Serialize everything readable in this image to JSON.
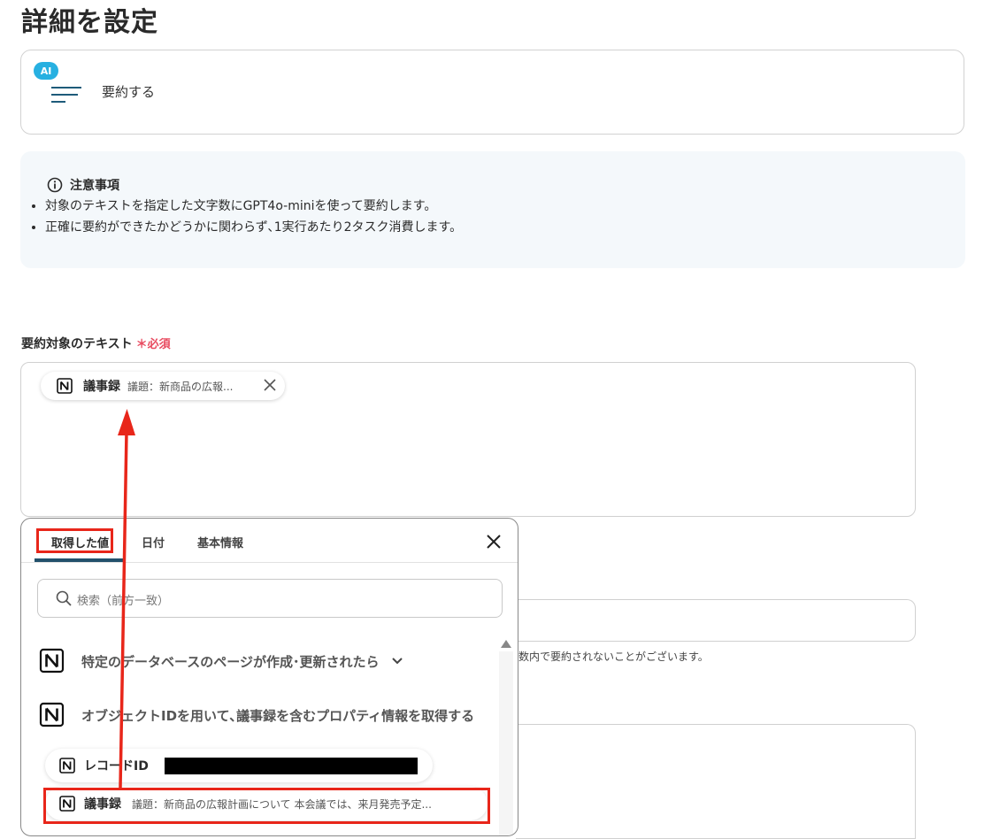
{
  "page": {
    "title": "詳細を設定"
  },
  "action": {
    "badge": "AI",
    "label": "要約する"
  },
  "notice": {
    "title": "注意事項",
    "items": [
      "対象のテキストを指定した文字数にGPT4o-miniを使って要約します。",
      "正確に要約ができたかどうかに関わらず､1実行あたり2タスク消費します。"
    ]
  },
  "field": {
    "label": "要約対象のテキスト",
    "required": "＊必須",
    "chip": {
      "name": "議事録",
      "value": "議題：新商品の広報..."
    }
  },
  "background": {
    "hint_fragment": "数内で要約されないことがございます。"
  },
  "popup": {
    "tabs": [
      "取得した値",
      "日付",
      "基本情報"
    ],
    "search_placeholder": "検索（前方一致）",
    "items": [
      {
        "label": "特定のデータベースのページが作成･更新されたら"
      },
      {
        "label": "オブジェクトIDを用いて､議事録を含むプロパティ情報を取得する"
      }
    ],
    "values": [
      {
        "name": "レコードID",
        "value": ""
      },
      {
        "name": "議事録",
        "value": "議題：新商品の広報計画について 本会議では、来月発売予定..."
      }
    ]
  },
  "colors": {
    "accent": "#22516b",
    "highlight": "#e8261a",
    "ai_badge": "#27b0e1",
    "required": "#e84a5f"
  }
}
